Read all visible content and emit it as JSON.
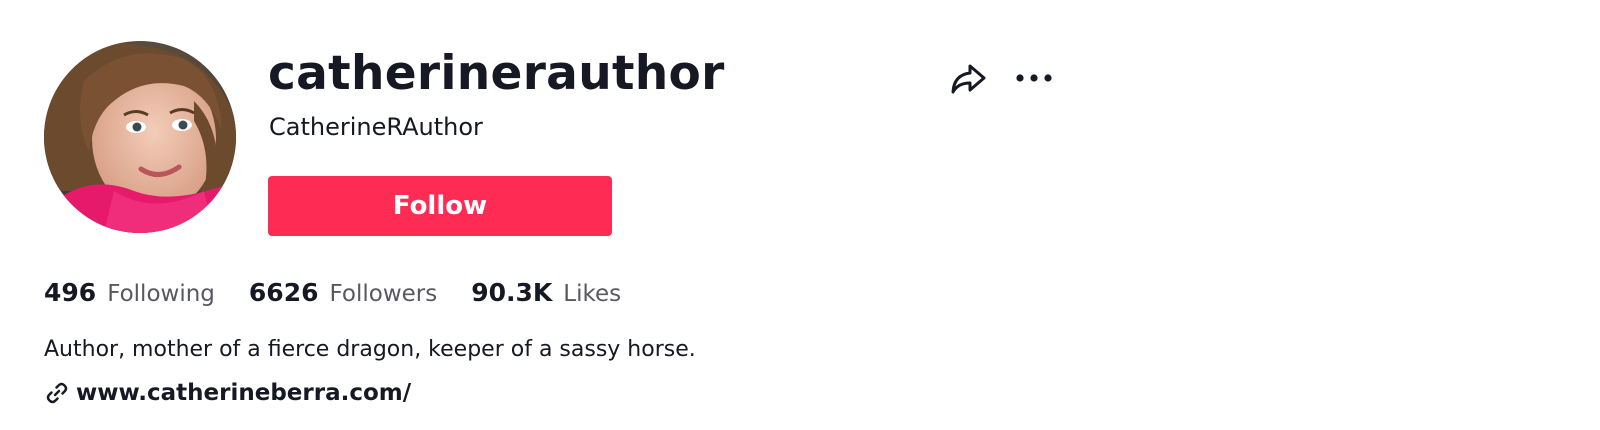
{
  "profile": {
    "username": "catherinerauthor",
    "display_name": "CatherineRAuthor",
    "avatar_icon": "profile-photo"
  },
  "actions": {
    "follow_label": "Follow",
    "follow_color": "#fe2c55",
    "share_icon": "share-arrow-icon",
    "more_icon": "more-dots-icon"
  },
  "stats": [
    {
      "value": "496",
      "label": "Following"
    },
    {
      "value": "6626",
      "label": "Followers"
    },
    {
      "value": "90.3K",
      "label": "Likes"
    }
  ],
  "bio": "Author, mother of a fierce dragon, keeper of a sassy horse.",
  "link": {
    "icon": "link-icon",
    "text": "www.catherineberra.com/"
  }
}
